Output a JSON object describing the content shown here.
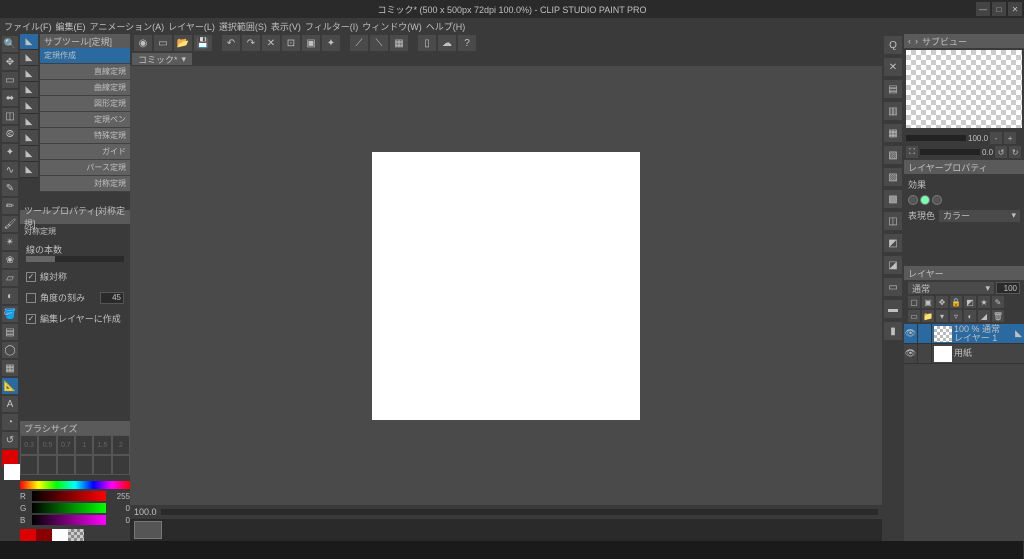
{
  "title": "コミック* (500 x 500px 72dpi 100.0%) - CLIP STUDIO PAINT PRO",
  "menu": [
    "ファイル(F)",
    "編集(E)",
    "アニメーション(A)",
    "レイヤー(L)",
    "選択範囲(S)",
    "表示(V)",
    "フィルター(I)",
    "ウィンドウ(W)",
    "ヘルプ(H)"
  ],
  "subtool_panel_title": "サブツール[定規]",
  "subtool_active": "定規作成",
  "subtools": [
    "直線定規",
    "曲線定規",
    "図形定規",
    "定規ペン",
    "特殊定規",
    "ガイド",
    "パース定規",
    "対称定規"
  ],
  "toolprop_panel_title": "ツールプロパティ[対称定規]",
  "toolprop_name": "対称定規",
  "prop": {
    "lines_label": "線の本数",
    "line_sym_label": "線対称",
    "angle_step_label": "角度の刻み",
    "angle_step_value": "45",
    "edit_layer_label": "編集レイヤーに作成"
  },
  "brush_panel_title": "ブラシサイズ",
  "brush_row1": [
    "0.3",
    "0.5",
    "0.7",
    "1",
    "1.5",
    "2"
  ],
  "brush_row2": [
    "",
    "",
    "",
    "",
    "",
    ""
  ],
  "rgb": {
    "r": "255",
    "g": "0",
    "b": "0"
  },
  "tab_name": "コミック*",
  "hscroll_zoom": "100.0",
  "nav_panel_title": "サブビュー",
  "nav_zoom": "100.0",
  "nav_angle": "0.0",
  "layerprop_title": "レイヤープロパティ",
  "layerprop_effect": "効果",
  "layerprop_exprcolor_label": "表現色",
  "layerprop_exprcolor_value": "カラー",
  "layer_panel_title": "レイヤー",
  "blend_mode": "通常",
  "opacity": "100",
  "layers": [
    {
      "name": "レイヤー 1",
      "opacity_text": "100 % 通常",
      "sel": true,
      "paper": false
    },
    {
      "name": "用紙",
      "opacity_text": "",
      "sel": false,
      "paper": true
    }
  ]
}
